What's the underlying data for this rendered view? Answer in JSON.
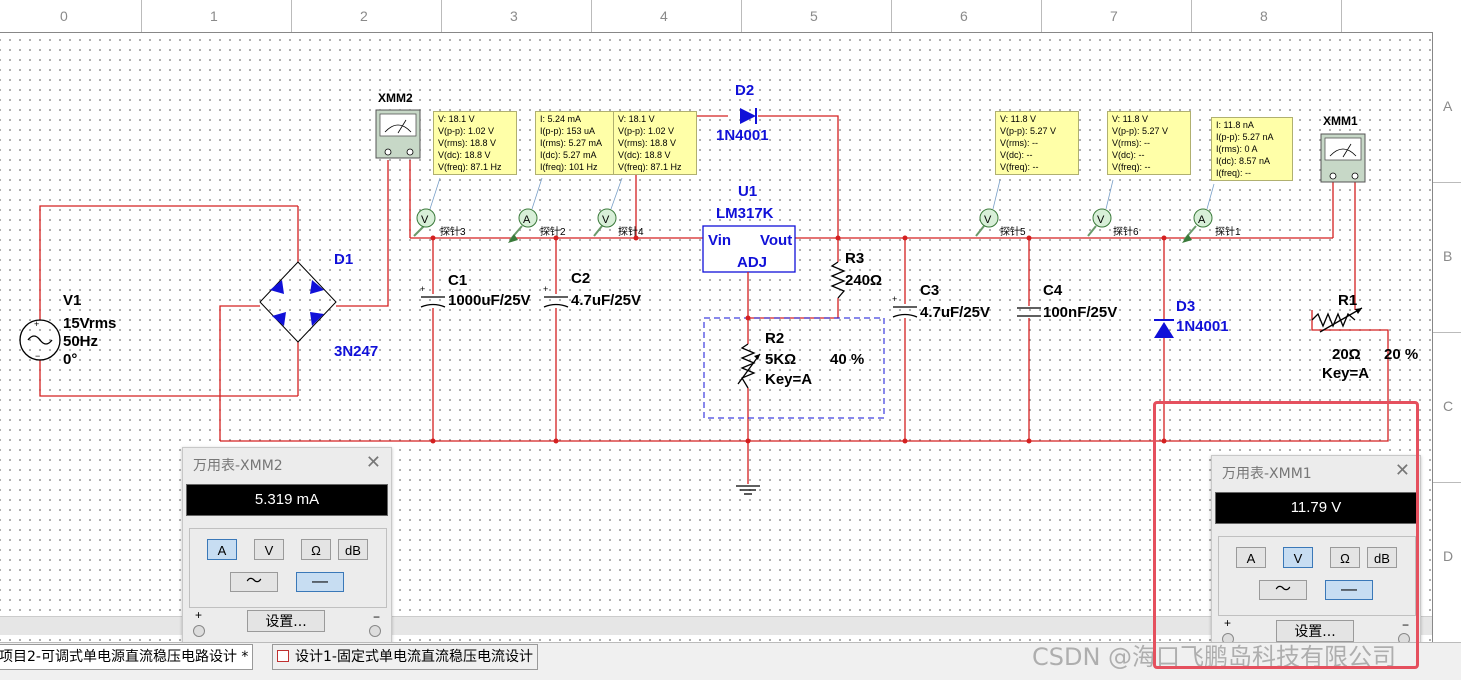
{
  "ruler": {
    "columns": [
      "0",
      "1",
      "2",
      "3",
      "4",
      "5",
      "6",
      "7",
      "8"
    ],
    "rows": [
      "A",
      "B",
      "C",
      "D"
    ]
  },
  "components": {
    "v1": {
      "name": "V1",
      "value": "15Vrms",
      "freq": "50Hz",
      "phase": "0°"
    },
    "d1": {
      "name": "D1",
      "model": "3N247"
    },
    "d2": {
      "name": "D2",
      "model": "1N4001"
    },
    "d3": {
      "name": "D3",
      "model": "1N4001"
    },
    "u1": {
      "name": "U1",
      "model": "LM317K",
      "pin_in": "Vin",
      "pin_out": "Vout",
      "pin_adj": "ADJ"
    },
    "c1": {
      "name": "C1",
      "value": "1000uF/25V"
    },
    "c2": {
      "name": "C2",
      "value": "4.7uF/25V"
    },
    "c3": {
      "name": "C3",
      "value": "4.7uF/25V"
    },
    "c4": {
      "name": "C4",
      "value": "100nF/25V"
    },
    "r2": {
      "name": "R2",
      "value": "5KΩ",
      "percent": "40 %",
      "key": "Key=A"
    },
    "r3": {
      "name": "R3",
      "value": "240Ω"
    },
    "r1": {
      "name": "R1",
      "value": "20Ω",
      "percent": "20 %",
      "key": "Key=A"
    },
    "xmm1": {
      "name": "XMM1"
    },
    "xmm2": {
      "name": "XMM2"
    }
  },
  "probes": {
    "p3": {
      "label": "探针3",
      "lines": [
        "V: 18.1 V",
        "V(p-p): 1.02 V",
        "V(rms): 18.8 V",
        "V(dc): 18.8 V",
        "V(freq): 87.1 Hz"
      ]
    },
    "p2": {
      "label": "探针2",
      "lines": [
        "I: 5.24 mA",
        "I(p-p): 153 uA",
        "I(rms): 5.27 mA",
        "I(dc): 5.27 mA",
        "I(freq): 101 Hz"
      ]
    },
    "p4": {
      "label": "探针4",
      "lines": [
        "V: 18.1 V",
        "V(p-p): 1.02 V",
        "V(rms): 18.8 V",
        "V(dc): 18.8 V",
        "V(freq): 87.1 Hz"
      ]
    },
    "p5": {
      "label": "探针5",
      "lines": [
        "V: 11.8 V",
        "V(p-p): 5.27 V",
        "V(rms): --",
        "V(dc): --",
        "V(freq): --"
      ]
    },
    "p6": {
      "label": "探针6",
      "lines": [
        "V: 11.8 V",
        "V(p-p): 5.27 V",
        "V(rms): --",
        "V(dc): --",
        "V(freq): --"
      ]
    },
    "p1": {
      "label": "探针1",
      "lines": [
        "I: 11.8 nA",
        "I(p-p): 5.27 nA",
        "I(rms): 0 A",
        "I(dc): 8.57 nA",
        "I(freq): --"
      ]
    }
  },
  "multimeters": {
    "xmm2": {
      "title": "万用表-XMM2",
      "reading": "5.319 mA",
      "active_mode": "A",
      "active_wave": "dc",
      "settings_label": "设置..."
    },
    "xmm1": {
      "title": "万用表-XMM1",
      "reading": "11.79 V",
      "active_mode": "V",
      "active_wave": "dc",
      "settings_label": "设置..."
    }
  },
  "mode_buttons": {
    "a": "A",
    "v": "V",
    "ohm": "Ω",
    "db": "dB"
  },
  "symbols": {
    "close": "✕",
    "ac": "〜",
    "dc": "—",
    "plus": "+",
    "minus": "−"
  },
  "tabs": [
    {
      "label": "项目2-可调式单电源直流稳压电路设计 *"
    },
    {
      "label": "设计1-固定式单电流直流稳压电流设计"
    }
  ],
  "watermark": "CSDN @海口飞鹏岛科技有限公司",
  "colors": {
    "wire": "#d42020",
    "label": "#1010d8",
    "probe_bg": "#ffffa8",
    "highlight": "#e5505e"
  }
}
